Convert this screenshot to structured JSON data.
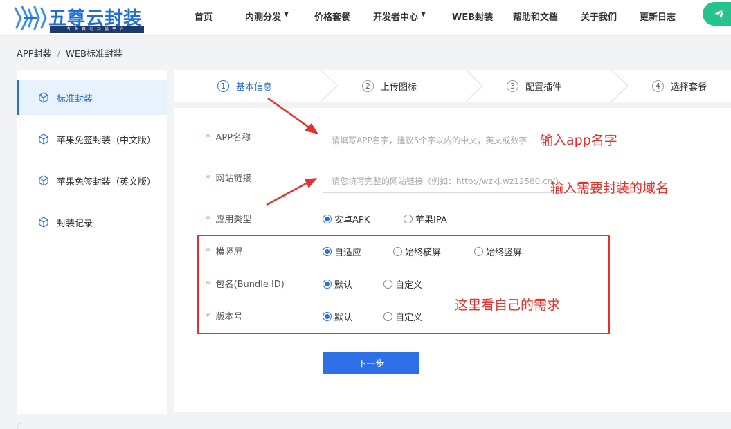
{
  "header": {
    "logo_title": "五尊云封装",
    "logo_subtitle": "专业自动封装平台",
    "nav": [
      {
        "label": "首页",
        "has_dropdown": false
      },
      {
        "label": "内测分发",
        "has_dropdown": true
      },
      {
        "label": "价格套餐",
        "has_dropdown": false
      },
      {
        "label": "开发者中心",
        "has_dropdown": true
      },
      {
        "label": "WEB封装",
        "has_dropdown": false
      },
      {
        "label": "帮助和文档",
        "has_dropdown": false
      },
      {
        "label": "关于我们",
        "has_dropdown": false
      },
      {
        "label": "更新日志",
        "has_dropdown": false
      }
    ],
    "cta_icon": "paper-plane-icon"
  },
  "breadcrumb": [
    "APP封装",
    "WEB标准封装"
  ],
  "sidebar": {
    "icon": "cube-icon",
    "items": [
      {
        "label": "标准封装",
        "active": true
      },
      {
        "label": "苹果免签封装（中文版）",
        "active": false
      },
      {
        "label": "苹果免签封装（英文版）",
        "active": false
      },
      {
        "label": "封装记录",
        "active": false
      }
    ]
  },
  "steps": [
    {
      "num": "1",
      "label": "基本信息",
      "active": true
    },
    {
      "num": "2",
      "label": "上传图标",
      "active": false
    },
    {
      "num": "3",
      "label": "配置插件",
      "active": false
    },
    {
      "num": "4",
      "label": "选择套餐",
      "active": false
    }
  ],
  "form": {
    "required_mark": "*",
    "app_name": {
      "label": "APP名称",
      "placeholder": "请填写APP名字，建议5个字以内的中文，英文或数字",
      "value": ""
    },
    "site_url": {
      "label": "网站链接",
      "placeholder": "请您填写完整的网站链接（例如：http://wzkj.wz12580.cn/）",
      "value": ""
    },
    "app_type": {
      "label": "应用类型",
      "options": [
        "安卓APK",
        "苹果IPA"
      ],
      "selected": 0
    },
    "orientation": {
      "label": "横竖屏",
      "options": [
        "自适应",
        "始终横屏",
        "始终竖屏"
      ],
      "selected": 0
    },
    "bundle_id": {
      "label": "包名(Bundle ID)",
      "options": [
        "默认",
        "自定义"
      ],
      "selected": 0
    },
    "version": {
      "label": "版本号",
      "options": [
        "默认",
        "自定义"
      ],
      "selected": 0
    },
    "next_button": "下一步"
  },
  "annotations": {
    "app_name_hint": "输入app名字",
    "domain_hint": "输入需要封装的域名",
    "options_hint": "这里看自己的需求",
    "color": "#e8302b"
  },
  "colors": {
    "primary": "#2d6fd8",
    "cta": "#27c38e",
    "required": "#f56c6c"
  }
}
